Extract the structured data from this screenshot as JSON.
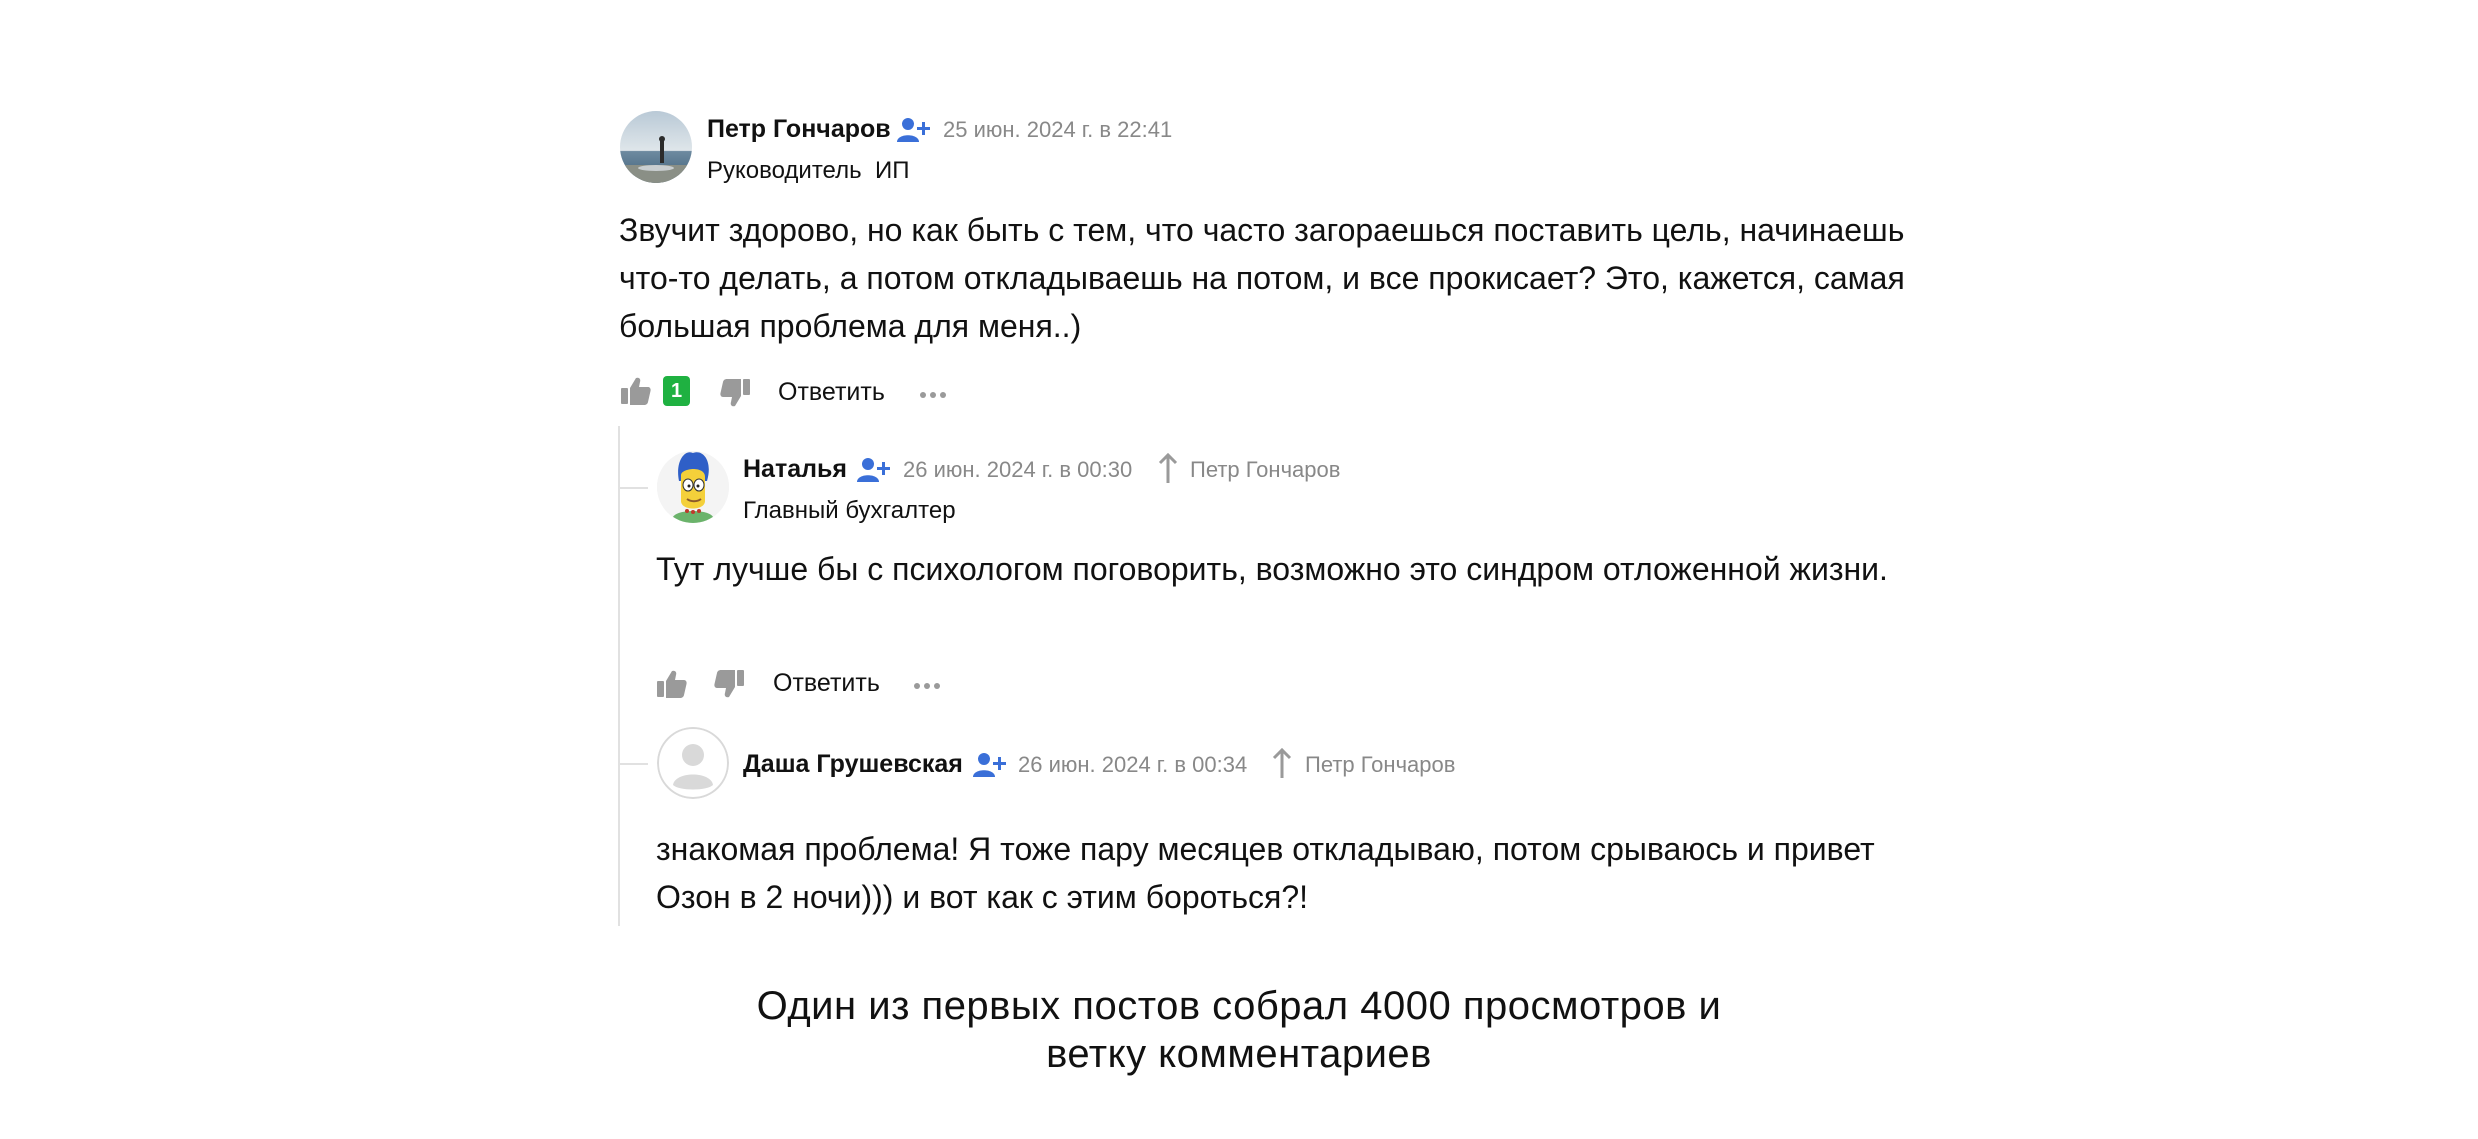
{
  "comments": [
    {
      "author": "Петр Гончаров",
      "date": "25 июн. 2024 г. в 22:41",
      "role": "Руководитель  ИП",
      "text": "Звучит здорово, но как быть с тем, что часто загораешься поставить цель, начинаешь что-то делать, а потом откладываешь на потом, и все прокисает? Это, кажется, самая большая проблема для меня..)",
      "likes": "1",
      "reply_label": "Ответить",
      "avatar": "landscape-photo-avatar"
    },
    {
      "author": "Наталья",
      "date": "26 июн. 2024 г. в 00:30",
      "reply_to": "Петр Гончаров",
      "role": "Главный бухгалтер",
      "text": "Тут лучше бы с психологом поговорить, возможно это синдром отложенной жизни.",
      "reply_label": "Ответить",
      "avatar": "cartoon-character-avatar"
    },
    {
      "author": "Даша Грушевская",
      "date": "26 июн. 2024 г. в 00:34",
      "reply_to": "Петр Гончаров",
      "text": "знакомая проблема! Я тоже пару месяцев откладываю, потом срываюсь и привет Озон в 2 ночи))) и вот как с этим бороться?!",
      "avatar": "default-user-avatar"
    }
  ],
  "caption": {
    "line1": "Один из первых постов собрал 4000 просмотров и",
    "line2": "ветку комментариев"
  },
  "colors": {
    "likes_badge": "#1fb141",
    "subscribe_icon": "#3a6fd8",
    "muted_text": "#888888",
    "icon_gray": "#9a9a9a"
  }
}
